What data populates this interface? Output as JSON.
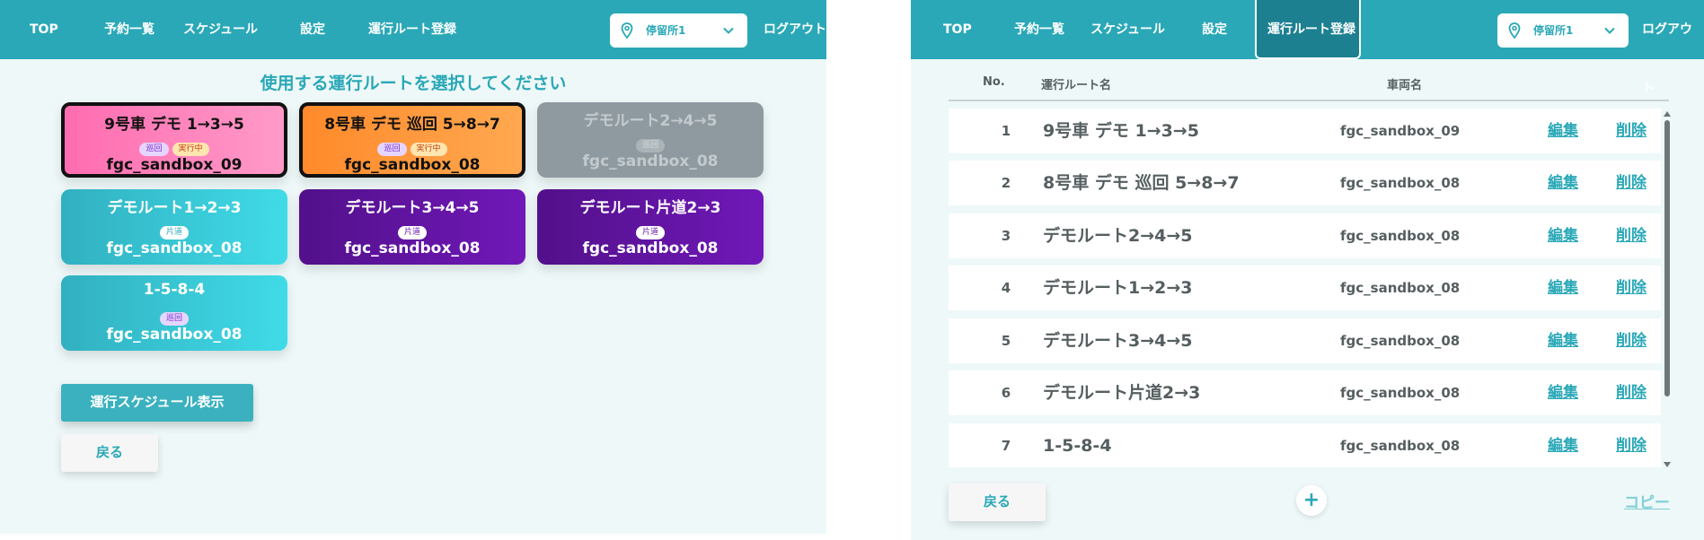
{
  "left": {
    "nav": {
      "top": "TOP",
      "reservations": "予約一覧",
      "schedule": "スケジュール",
      "settings": "設定",
      "route_register": "運行ルート登録"
    },
    "stop_select": {
      "value": "停留所1"
    },
    "logout": "ログアウト",
    "title": "使用する運行ルートを選択してください",
    "cards": [
      {
        "name": "9号車 デモ 1→3→5",
        "badges": [
          "巡回",
          "実行中"
        ],
        "car": "fgc_sandbox_09"
      },
      {
        "name": "8号車 デモ 巡回 5→8→7",
        "badges": [
          "巡回",
          "実行中"
        ],
        "car": "fgc_sandbox_08"
      },
      {
        "name": "デモルート2→4→5",
        "badges": [
          "巡回"
        ],
        "car": "fgc_sandbox_08"
      },
      {
        "name": "デモルート1→2→3",
        "badges": [
          "片道"
        ],
        "car": "fgc_sandbox_08"
      },
      {
        "name": "デモルート3→4→5",
        "badges": [
          "片道"
        ],
        "car": "fgc_sandbox_08"
      },
      {
        "name": "デモルート片道2→3",
        "badges": [
          "片道"
        ],
        "car": "fgc_sandbox_08"
      },
      {
        "name": "1-5-8-4",
        "badges": [
          "巡回"
        ],
        "car": "fgc_sandbox_08"
      }
    ],
    "schedule_button": "運行スケジュール表示",
    "back_button": "戻る"
  },
  "right": {
    "nav": {
      "top": "TOP",
      "reservations": "予約一覧",
      "schedule": "スケジュール",
      "settings": "設定",
      "route_register": "運行ルート登録"
    },
    "stop_select": {
      "value": "停留所1"
    },
    "logout": "ログアウト",
    "columns": {
      "no": "No.",
      "route": "運行ルート名",
      "car": "車両名"
    },
    "rows": [
      {
        "no": "1",
        "name": "9号車 デモ 1→3→5",
        "car": "fgc_sandbox_09",
        "edit": "編集",
        "delete": "削除"
      },
      {
        "no": "2",
        "name": "8号車 デモ 巡回 5→8→7",
        "car": "fgc_sandbox_08",
        "edit": "編集",
        "delete": "削除"
      },
      {
        "no": "3",
        "name": "デモルート2→4→5",
        "car": "fgc_sandbox_08",
        "edit": "編集",
        "delete": "削除"
      },
      {
        "no": "4",
        "name": "デモルート1→2→3",
        "car": "fgc_sandbox_08",
        "edit": "編集",
        "delete": "削除"
      },
      {
        "no": "5",
        "name": "デモルート3→4→5",
        "car": "fgc_sandbox_08",
        "edit": "編集",
        "delete": "削除"
      },
      {
        "no": "6",
        "name": "デモルート片道2→3",
        "car": "fgc_sandbox_08",
        "edit": "編集",
        "delete": "削除"
      },
      {
        "no": "7",
        "name": "1-5-8-4",
        "car": "fgc_sandbox_08",
        "edit": "編集",
        "delete": "削除"
      }
    ],
    "back_button": "戻る",
    "add_button": "+",
    "copy_link": "コピー"
  },
  "colors": {
    "primary": "#2aa8b7",
    "nav_active": "#1d8090",
    "background": "#eef8f8",
    "pink": "#ff7ab8",
    "orange": "#ff952f",
    "gray": "#8f9aa0",
    "teal": "#38c6d4",
    "purple": "#5e14a0"
  },
  "icons": {
    "stop_select": "map-pin-icon",
    "dropdown": "chevron-down-icon",
    "add": "plus-icon"
  }
}
